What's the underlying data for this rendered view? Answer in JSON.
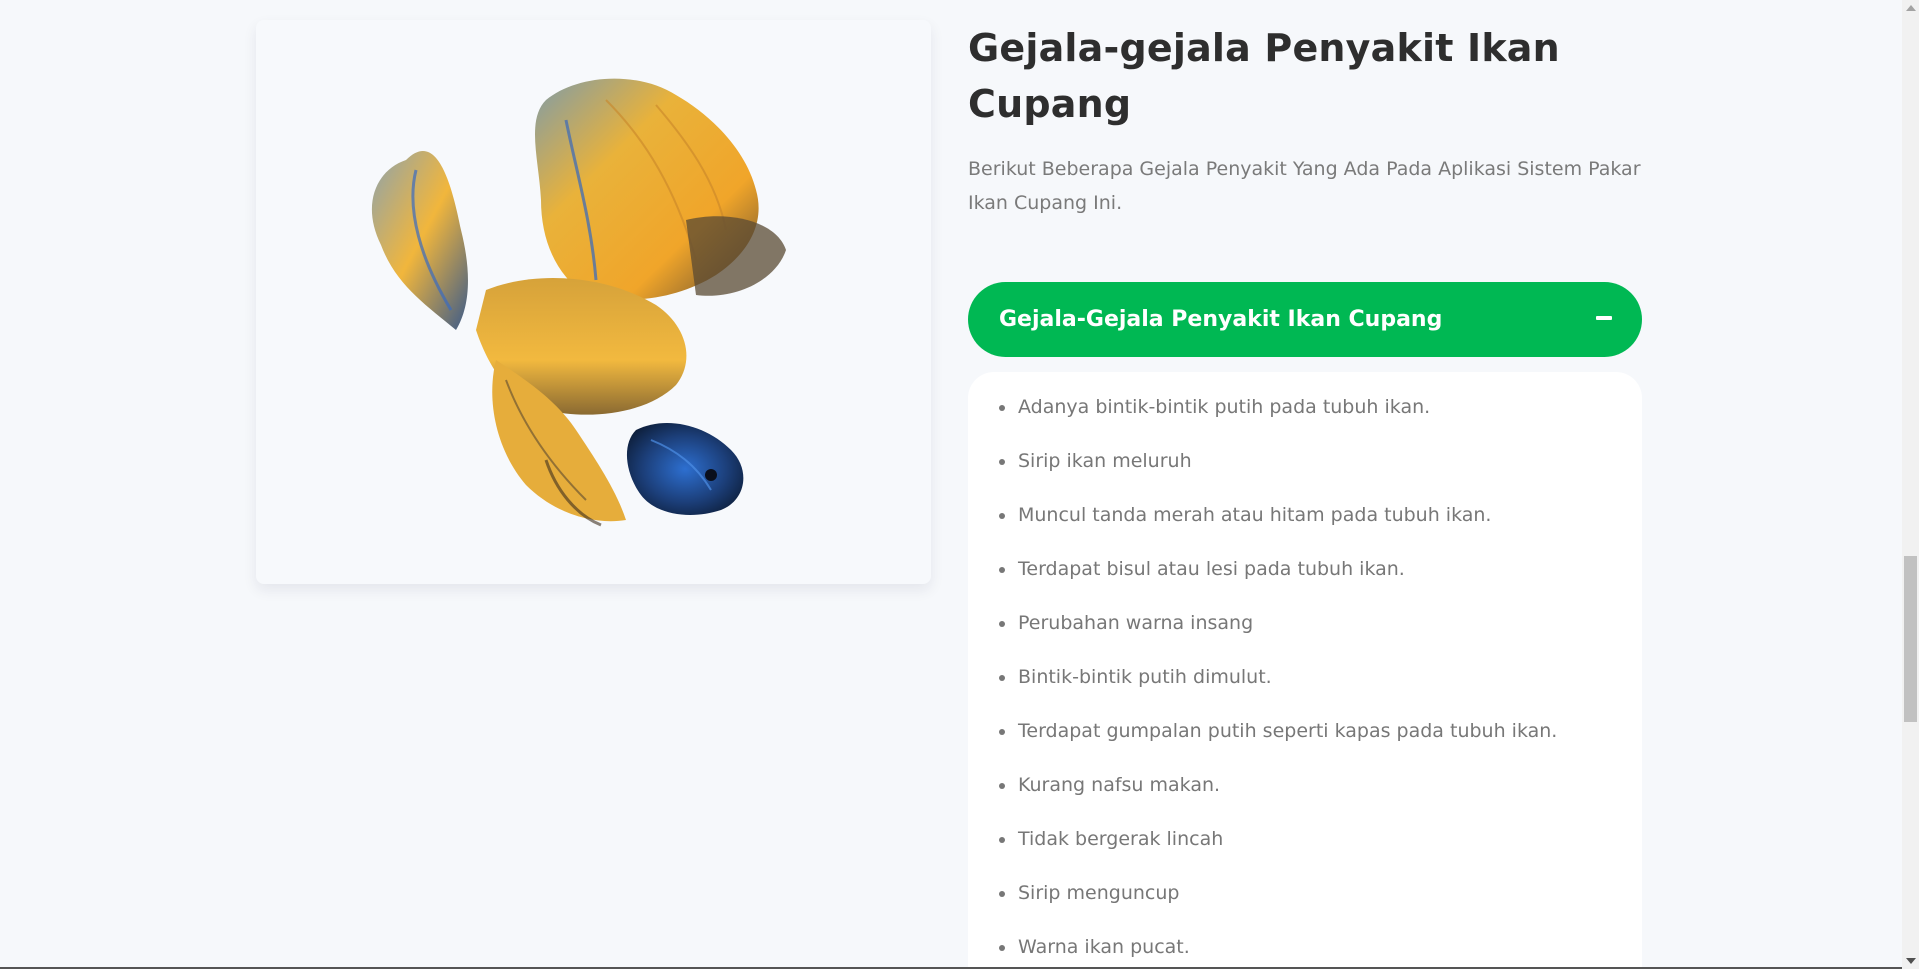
{
  "section": {
    "title": "Gejala-gejala Penyakit Ikan Cupang",
    "subtitle": "Berikut Beberapa Gejala Penyakit Yang Ada Pada Aplikasi Sistem Pakar Ikan Cupang Ini."
  },
  "accordion": {
    "header_label": "Gejala-Gejala Penyakit Ikan Cupang",
    "toggle_icon": "minus-icon",
    "expanded": true,
    "items": [
      "Adanya bintik-bintik putih pada tubuh ikan.",
      "Sirip ikan meluruh",
      "Muncul tanda merah atau hitam pada tubuh ikan.",
      "Terdapat bisul atau lesi pada tubuh ikan.",
      "Perubahan warna insang",
      "Bintik-bintik putih dimulut.",
      "Terdapat gumpalan putih seperti kapas pada tubuh ikan.",
      "Kurang nafsu makan.",
      "Tidak bergerak lincah",
      "Sirip menguncup",
      "Warna ikan pucat."
    ]
  },
  "image": {
    "subject": "betta-fish-image"
  },
  "colors": {
    "accent": "#00b853",
    "background": "#f6f8fb",
    "heading": "#2e2e2e",
    "body_text": "#777777"
  }
}
